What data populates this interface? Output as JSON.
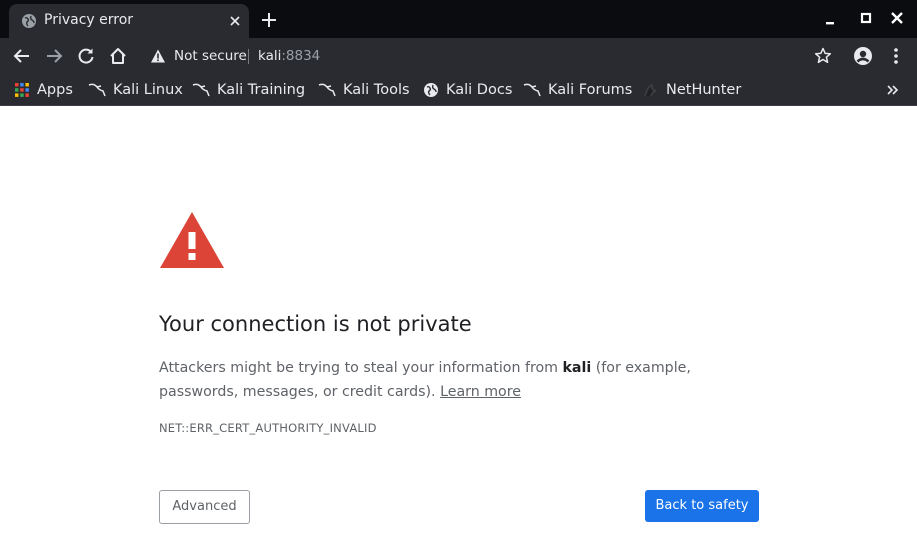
{
  "browser": {
    "tab": {
      "title": "Privacy error",
      "favicon": "globe-icon"
    },
    "omnibox": {
      "security_label": "Not secure",
      "host": "kali",
      "port": ":8834"
    },
    "bookmarks": [
      {
        "label": "Apps",
        "icon": "apps-grid-icon"
      },
      {
        "label": "Kali Linux",
        "icon": "kali-dragon-icon"
      },
      {
        "label": "Kali Training",
        "icon": "kali-dragon-icon"
      },
      {
        "label": "Kali Tools",
        "icon": "kali-dragon-icon"
      },
      {
        "label": "Kali Docs",
        "icon": "globe-icon"
      },
      {
        "label": "Kali Forums",
        "icon": "kali-dragon-icon"
      },
      {
        "label": "NetHunter",
        "icon": "nethunter-icon"
      }
    ]
  },
  "page": {
    "heading": "Your connection is not private",
    "description_before": "Attackers might be trying to steal your information from ",
    "description_host": "kali",
    "description_after": " (for example, passwords, messages, or credit cards). ",
    "learn_more": "Learn more",
    "error_code": "NET::ERR_CERT_AUTHORITY_INVALID",
    "advanced_label": "Advanced",
    "back_label": "Back to safety"
  },
  "colors": {
    "titlebar": "#0b0c10",
    "toolbar": "#2a2b30",
    "warning_red": "#db4437",
    "primary_blue": "#1a73e8"
  }
}
